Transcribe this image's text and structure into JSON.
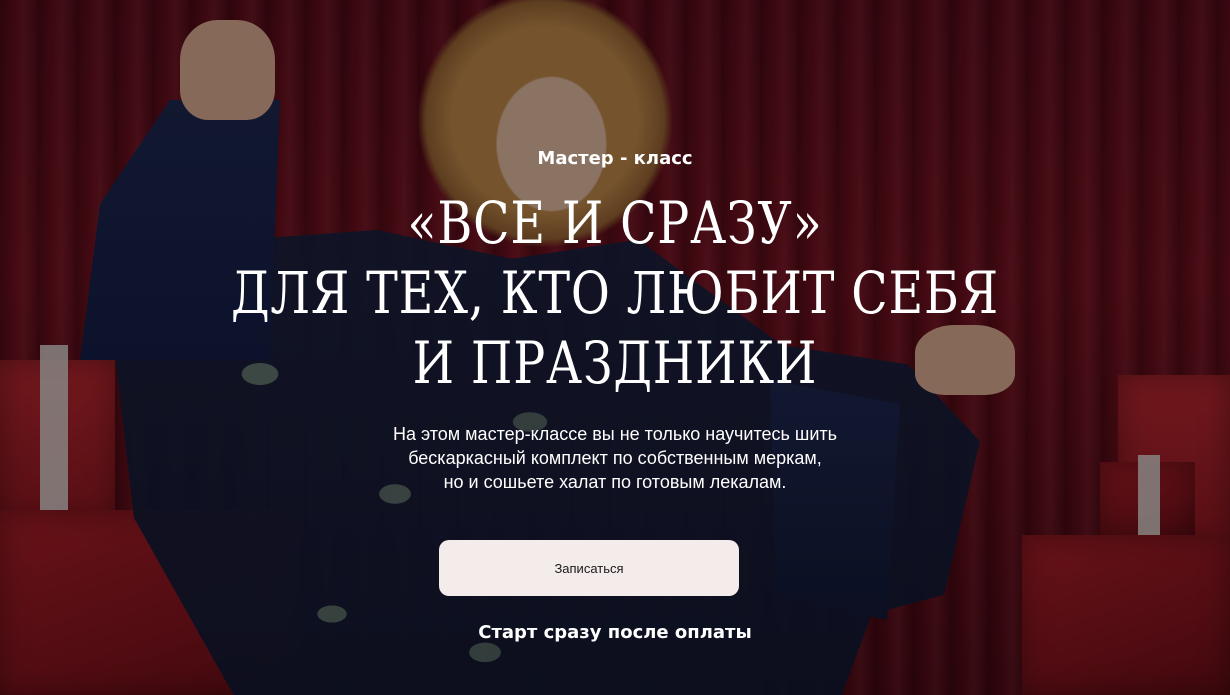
{
  "hero": {
    "eyebrow": "Мастер - класс",
    "headline_lines": [
      "«Все и сразу»",
      "для тех, кто любит себя",
      "и праздники"
    ],
    "description_lines": [
      "На этом мастер-классе вы не только научитесь шить",
      "бескаркасный комплект по собственным меркам,",
      "но и сошьете халат по готовым лекалам."
    ],
    "cta_label": "Записаться",
    "footnote": "Старт сразу после оплаты"
  },
  "colors": {
    "button_bg": "#f4ecea",
    "text": "#ffffff",
    "curtain": "#7d1222"
  }
}
